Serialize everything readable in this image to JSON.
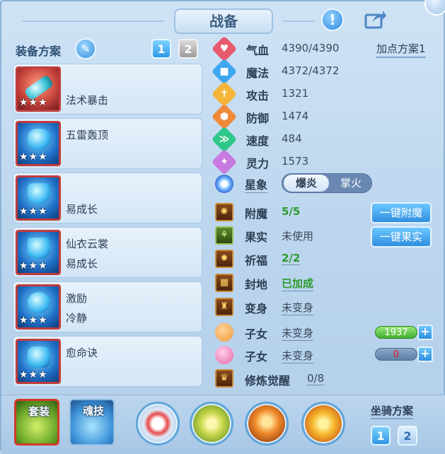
{
  "header": {
    "title": "战备",
    "alert_glyph": "!"
  },
  "equip_section": {
    "title": "装备方案",
    "plan_buttons": [
      "1",
      "2"
    ],
    "active_plan": "1"
  },
  "equipment": [
    {
      "line1": "",
      "line2": "法术暴击",
      "stars": "★★★"
    },
    {
      "line1": "五雷轰顶",
      "line2": "",
      "stars": "★★★"
    },
    {
      "line1": "",
      "line2": "易成长",
      "stars": "★★★"
    },
    {
      "line1": "仙衣云裳",
      "line2": "易成长",
      "stars": "★★★"
    },
    {
      "line1": "激励",
      "line2": "冷静",
      "stars": "★★★"
    },
    {
      "line1": "愈命诀",
      "line2": "",
      "stars": "★★★"
    }
  ],
  "stats": [
    {
      "label": "气血",
      "value": "4390/4390",
      "color": "#e85a6e",
      "icon": "♥"
    },
    {
      "label": "魔法",
      "value": "4372/4372",
      "color": "#3fa7f0",
      "icon": "■"
    },
    {
      "label": "攻击",
      "value": "1321",
      "color": "#f4b53a",
      "icon": "✝"
    },
    {
      "label": "防御",
      "value": "1474",
      "color": "#f08a3a",
      "icon": "⬢"
    },
    {
      "label": "速度",
      "value": "484",
      "color": "#2fc68a",
      "icon": "≫"
    },
    {
      "label": "灵力",
      "value": "1573",
      "color": "#c77be0",
      "icon": "✦"
    }
  ],
  "add_point_plan": "加点方案1",
  "star_sign": {
    "label": "星象",
    "options": [
      "爆炎",
      "掌火"
    ],
    "selected": "爆炎"
  },
  "extras": [
    {
      "label": "附魔",
      "value": "5/5",
      "green": true
    },
    {
      "label": "果实",
      "value": "未使用",
      "green": false
    },
    {
      "label": "祈福",
      "value": "2/2",
      "green": true
    },
    {
      "label": "封地",
      "value": "已加成",
      "green": true
    },
    {
      "label": "变身",
      "value": "未变身",
      "green": false
    }
  ],
  "buttons": {
    "enchant": "一键附魔",
    "fruit": "一键果实"
  },
  "children": [
    {
      "label": "子女",
      "value": "未变身",
      "bar": "1937"
    },
    {
      "label": "子女",
      "value": "未变身",
      "bar": "0"
    }
  ],
  "cultivation": {
    "label": "修炼觉醒",
    "value": "0/8"
  },
  "bottom": {
    "tabs": [
      "套装",
      "魂技"
    ],
    "mount_label": "坐骑方案",
    "mount_buttons": [
      "1",
      "2"
    ],
    "active_mount": "1"
  }
}
